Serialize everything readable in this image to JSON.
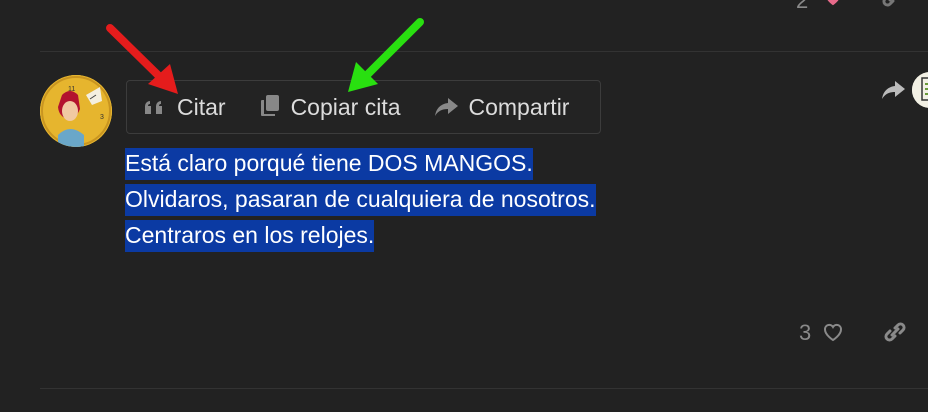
{
  "previous_post": {
    "like_count": "2",
    "like_icon": "heart-icon",
    "link_icon": "link-icon"
  },
  "quote_bar": {
    "cite_label": "Citar",
    "cite_icon": "quote-icon",
    "copy_label": "Copiar cita",
    "copy_icon": "copy-icon",
    "share_label": "Compartir",
    "share_icon": "share-icon"
  },
  "post": {
    "lines": [
      "Está claro porqué tiene DOS MANGOS.",
      "Olvidaros, pasaran de cualquiera de nosotros.",
      "Centraros en los relojes."
    ],
    "like_count": "3",
    "like_icon": "heart-outline-icon",
    "link_icon": "link-icon",
    "reply_icon": "reply-icon"
  },
  "colors": {
    "background": "#222222",
    "selection": "#0b3aa3",
    "like_heart": "#e86a8a",
    "annotation_red": "#e51c1c",
    "annotation_green": "#29e010"
  }
}
